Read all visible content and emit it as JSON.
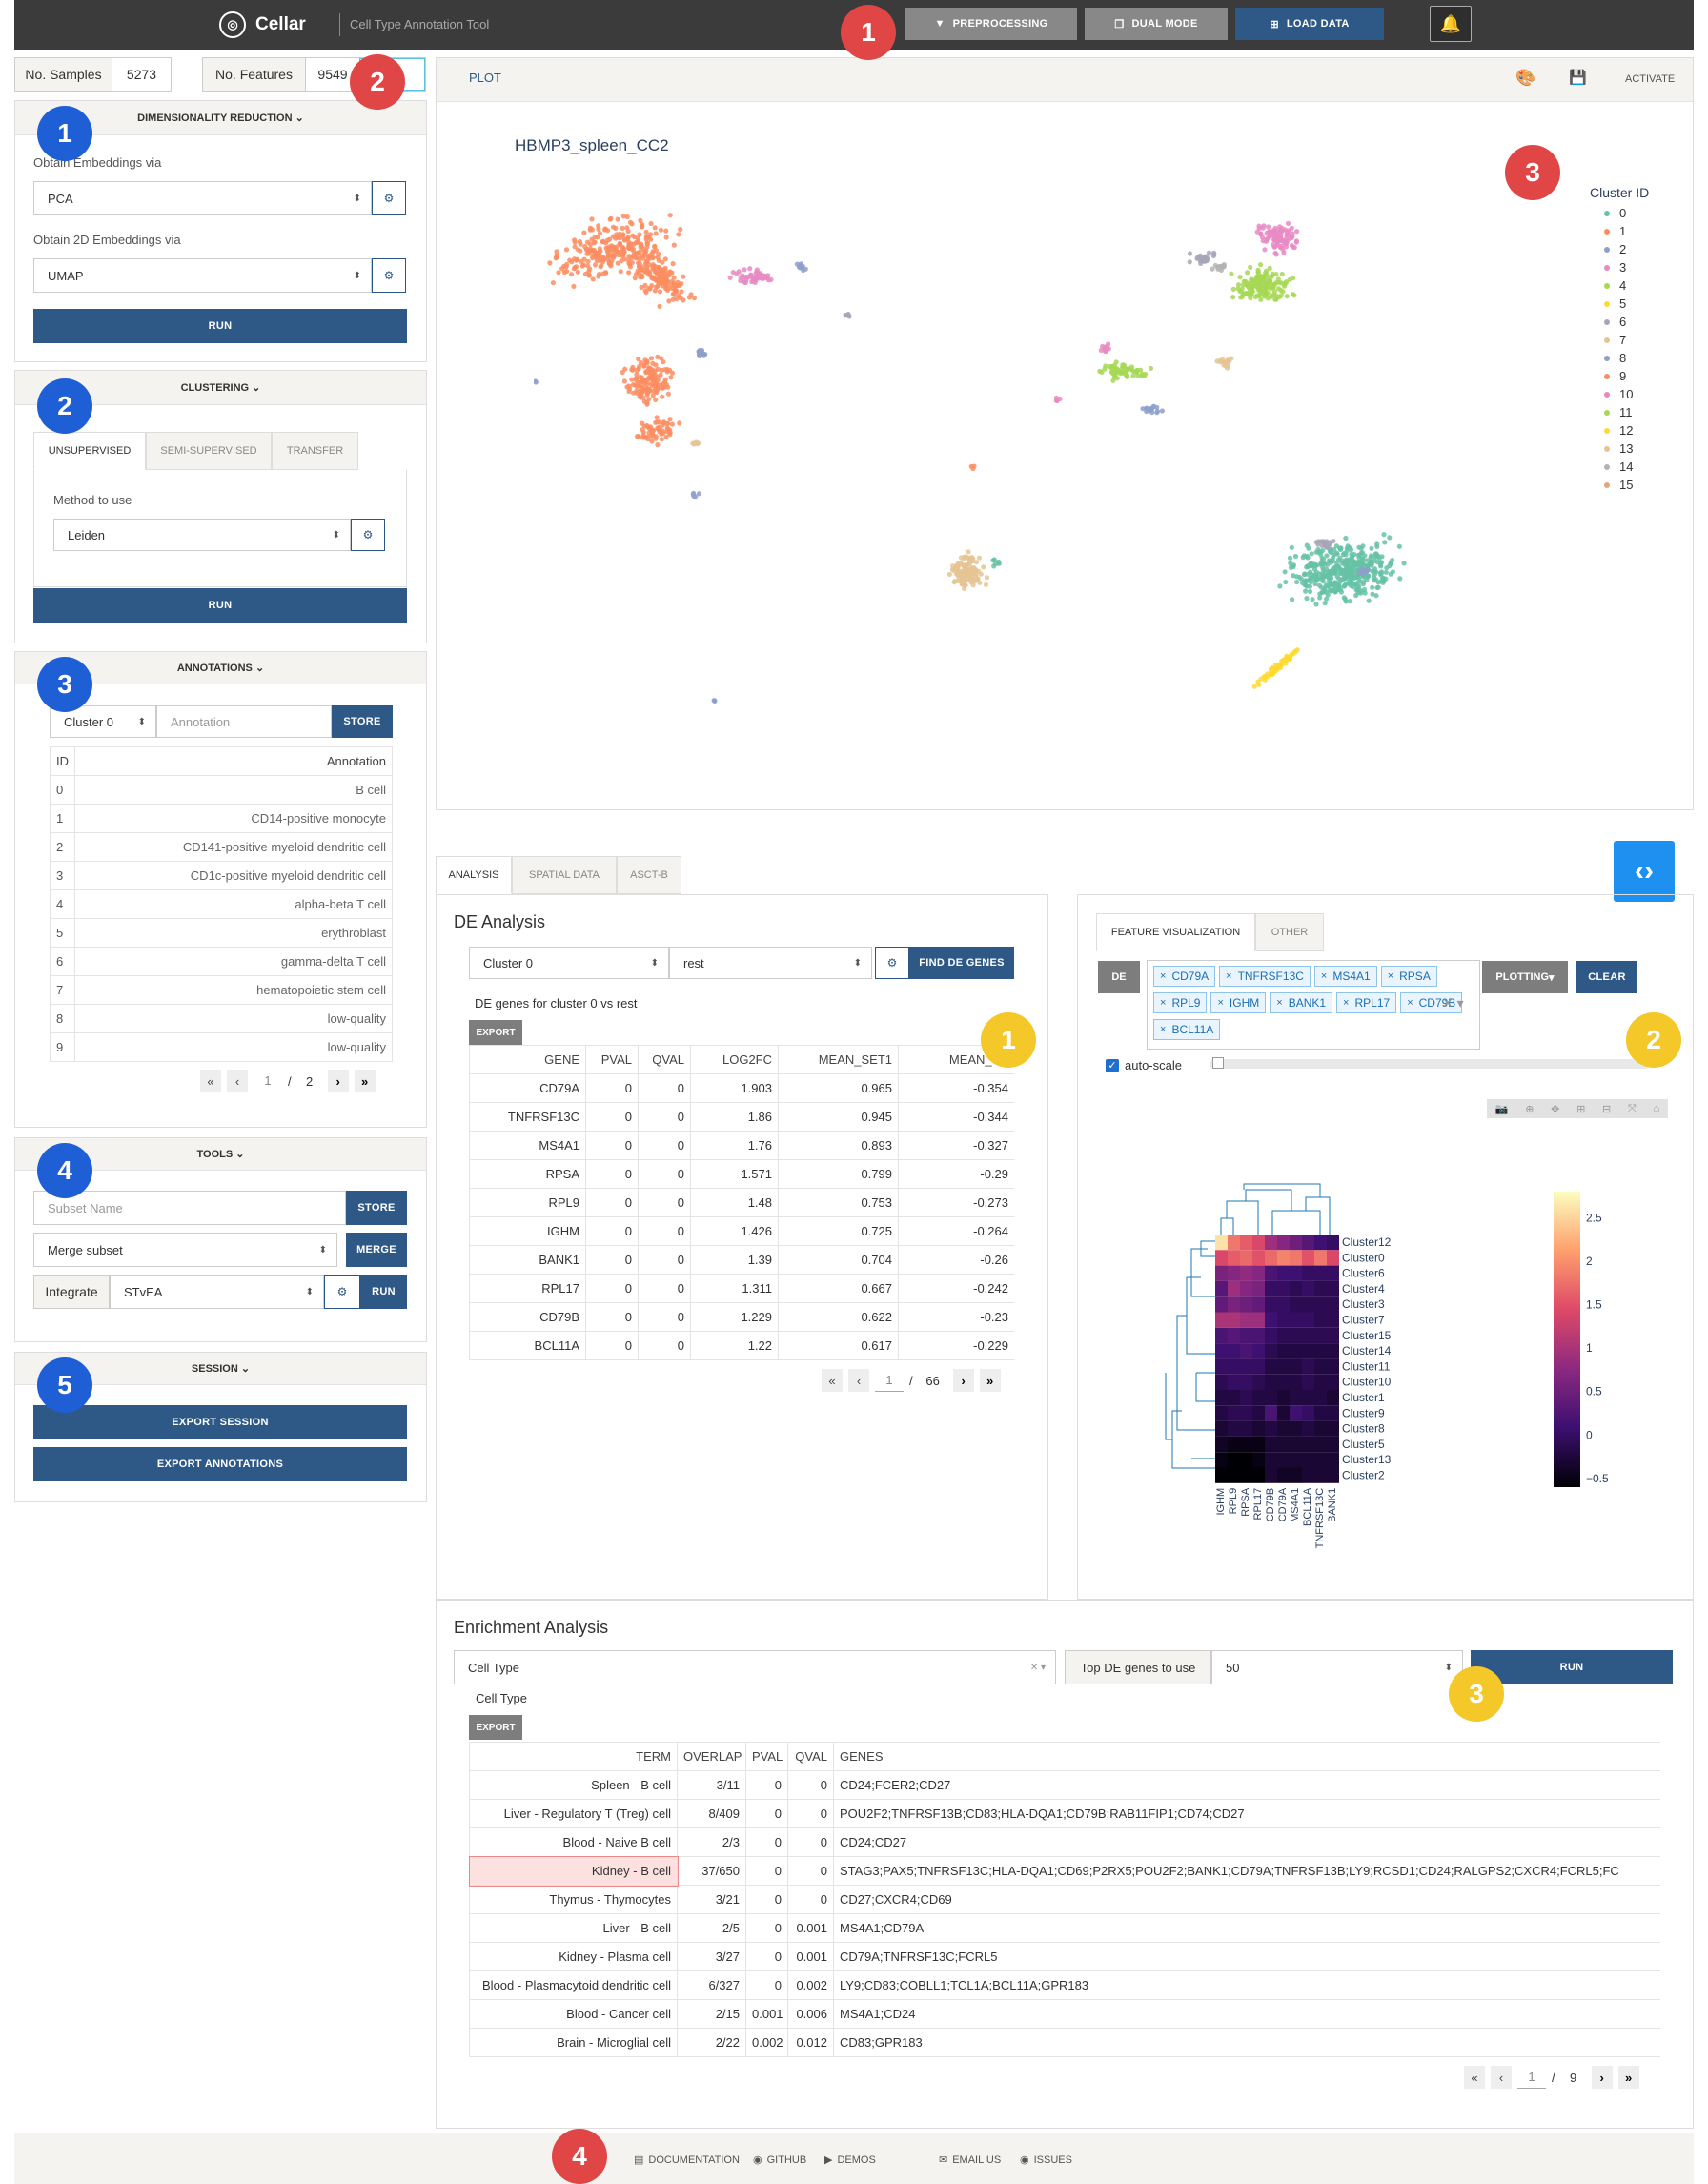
{
  "header": {
    "app_name": "Cellar",
    "subtitle": "Cell Type Annotation Tool",
    "buttons": [
      {
        "label": "PREPROCESSING",
        "icon": "filter-icon",
        "color": "#888888"
      },
      {
        "label": "DUAL MODE",
        "icon": "copy-icon",
        "color": "#888888"
      },
      {
        "label": "LOAD DATA",
        "icon": "plus-square-icon",
        "color": "#2e5987"
      }
    ]
  },
  "stats": {
    "samples_label": "No. Samples",
    "samples_value": "5273",
    "features_label": "No. Features",
    "features_value": "9549"
  },
  "dimred": {
    "title": "DIMENSIONALITY REDUCTION",
    "embed_label": "Obtain Embeddings via",
    "embed_value": "PCA",
    "embed2d_label": "Obtain 2D Embeddings via",
    "embed2d_value": "UMAP",
    "run": "RUN"
  },
  "clustering": {
    "title": "CLUSTERING",
    "tabs": [
      "UNSUPERVISED",
      "SEMI-SUPERVISED",
      "TRANSFER"
    ],
    "method_label": "Method to use",
    "method_value": "Leiden",
    "run": "RUN"
  },
  "annotations": {
    "title": "ANNOTATIONS",
    "cluster_select": "Cluster 0",
    "annotation_placeholder": "Annotation",
    "store": "STORE",
    "col_id": "ID",
    "col_annotation": "Annotation",
    "rows": [
      {
        "id": "0",
        "name": "B cell"
      },
      {
        "id": "1",
        "name": "CD14-positive monocyte"
      },
      {
        "id": "2",
        "name": "CD141-positive myeloid dendritic cell"
      },
      {
        "id": "3",
        "name": "CD1c-positive myeloid dendritic cell"
      },
      {
        "id": "4",
        "name": "alpha-beta T cell"
      },
      {
        "id": "5",
        "name": "erythroblast"
      },
      {
        "id": "6",
        "name": "gamma-delta T cell"
      },
      {
        "id": "7",
        "name": "hematopoietic stem cell"
      },
      {
        "id": "8",
        "name": "low-quality"
      },
      {
        "id": "9",
        "name": "low-quality"
      }
    ],
    "page": "1",
    "sep": "/",
    "pages": "2"
  },
  "tools": {
    "title": "TOOLS",
    "subset_placeholder": "Subset Name",
    "store": "STORE",
    "merge_value": "Merge subset",
    "merge": "MERGE",
    "integrate_label": "Integrate",
    "integrate_value": "STvEA",
    "run": "RUN"
  },
  "session": {
    "title": "SESSION",
    "export_session": "EXPORT SESSION",
    "export_annotations": "EXPORT ANNOTATIONS"
  },
  "plot": {
    "header": "PLOT",
    "activate": "ACTIVATE",
    "dataset_title": "HBMP3_spleen_CC2",
    "legend_title": "Cluster ID",
    "clusters": [
      {
        "id": "0",
        "color": "#66c2a5"
      },
      {
        "id": "1",
        "color": "#fc8d62"
      },
      {
        "id": "2",
        "color": "#8da0cb"
      },
      {
        "id": "3",
        "color": "#e78ac3"
      },
      {
        "id": "4",
        "color": "#a6d854"
      },
      {
        "id": "5",
        "color": "#ffd92f"
      },
      {
        "id": "6",
        "color": "#a6a6b8"
      },
      {
        "id": "7",
        "color": "#e5c494"
      },
      {
        "id": "8",
        "color": "#8da0cb"
      },
      {
        "id": "9",
        "color": "#fc8d62"
      },
      {
        "id": "10",
        "color": "#e78ac3"
      },
      {
        "id": "11",
        "color": "#a6d854"
      },
      {
        "id": "12",
        "color": "#ffd92f"
      },
      {
        "id": "13",
        "color": "#e5c494"
      },
      {
        "id": "14",
        "color": "#b3b3b3"
      },
      {
        "id": "15",
        "color": "#e5a77a"
      }
    ]
  },
  "analysis_tabs": [
    "ANALYSIS",
    "SPATIAL DATA",
    "ASCT-B"
  ],
  "de": {
    "title": "DE Analysis",
    "cluster": "Cluster 0",
    "vs": "rest",
    "find_btn": "FIND DE GENES",
    "caption": "DE genes for cluster 0 vs rest",
    "export": "EXPORT",
    "columns": [
      "GENE",
      "PVAL",
      "QVAL",
      "LOG2FC",
      "MEAN_SET1",
      "MEAN_SE"
    ],
    "rows": [
      [
        "CD79A",
        "0",
        "0",
        "1.903",
        "0.965",
        "-0.354"
      ],
      [
        "TNFRSF13C",
        "0",
        "0",
        "1.86",
        "0.945",
        "-0.344"
      ],
      [
        "MS4A1",
        "0",
        "0",
        "1.76",
        "0.893",
        "-0.327"
      ],
      [
        "RPSA",
        "0",
        "0",
        "1.571",
        "0.799",
        "-0.29"
      ],
      [
        "RPL9",
        "0",
        "0",
        "1.48",
        "0.753",
        "-0.273"
      ],
      [
        "IGHM",
        "0",
        "0",
        "1.426",
        "0.725",
        "-0.264"
      ],
      [
        "BANK1",
        "0",
        "0",
        "1.39",
        "0.704",
        "-0.26"
      ],
      [
        "RPL17",
        "0",
        "0",
        "1.311",
        "0.667",
        "-0.242"
      ],
      [
        "CD79B",
        "0",
        "0",
        "1.229",
        "0.622",
        "-0.23"
      ],
      [
        "BCL11A",
        "0",
        "0",
        "1.22",
        "0.617",
        "-0.229"
      ]
    ],
    "page": "1",
    "sep": "/",
    "pages": "66"
  },
  "feature_vis": {
    "tabs": [
      "FEATURE VISUALIZATION",
      "OTHER"
    ],
    "de_label": "DE",
    "chips": [
      "CD79A",
      "TNFRSF13C",
      "MS4A1",
      "RPSA",
      "RPL9",
      "IGHM",
      "BANK1",
      "RPL17",
      "CD79B",
      "BCL11A"
    ],
    "plotting": "PLOTTING",
    "clear": "CLEAR",
    "autoscale": "auto-scale"
  },
  "chart_data": {
    "type": "heatmap",
    "rows": [
      "Cluster12",
      "Cluster0",
      "Cluster6",
      "Cluster4",
      "Cluster3",
      "Cluster7",
      "Cluster15",
      "Cluster14",
      "Cluster11",
      "Cluster10",
      "Cluster1",
      "Cluster9",
      "Cluster8",
      "Cluster5",
      "Cluster13",
      "Cluster2"
    ],
    "columns": [
      "IGHM",
      "RPL9",
      "RPSA",
      "RPL17",
      "CD79B",
      "CD79A",
      "MS4A1",
      "BCL11A",
      "TNFRSF13C",
      "BANK1"
    ],
    "values": [
      [
        2.6,
        1.8,
        1.6,
        1.4,
        0.9,
        0.7,
        0.5,
        0.3,
        0.1,
        0.0
      ],
      [
        1.4,
        1.6,
        1.7,
        1.5,
        1.7,
        1.9,
        1.8,
        1.5,
        1.8,
        1.4
      ],
      [
        0.6,
        0.7,
        0.8,
        0.7,
        0.2,
        0.1,
        0.1,
        0.0,
        0.0,
        0.0
      ],
      [
        0.3,
        0.9,
        0.7,
        0.6,
        0.0,
        0.0,
        -0.1,
        0.0,
        -0.1,
        -0.1
      ],
      [
        0.4,
        0.6,
        0.5,
        0.4,
        0.0,
        0.0,
        -0.1,
        -0.1,
        -0.1,
        -0.1
      ],
      [
        1.0,
        1.0,
        0.9,
        0.9,
        0.1,
        0.0,
        0.0,
        0.0,
        -0.1,
        -0.1
      ],
      [
        0.2,
        0.3,
        0.2,
        0.2,
        0.0,
        -0.1,
        -0.1,
        -0.1,
        -0.1,
        -0.1
      ],
      [
        0.1,
        0.1,
        0.2,
        0.1,
        -0.1,
        -0.2,
        -0.2,
        -0.2,
        -0.2,
        -0.2
      ],
      [
        0.0,
        0.0,
        0.0,
        0.0,
        -0.2,
        -0.2,
        -0.2,
        -0.1,
        -0.2,
        -0.2
      ],
      [
        -0.1,
        0.0,
        0.0,
        -0.1,
        -0.2,
        -0.2,
        -0.2,
        -0.1,
        -0.2,
        -0.2
      ],
      [
        -0.2,
        -0.2,
        -0.1,
        -0.2,
        -0.2,
        -0.3,
        -0.2,
        -0.2,
        -0.2,
        -0.3
      ],
      [
        -0.2,
        -0.1,
        -0.1,
        -0.2,
        0.2,
        -0.3,
        0.1,
        0.0,
        -0.2,
        -0.2
      ],
      [
        -0.3,
        -0.2,
        -0.2,
        -0.3,
        -0.2,
        -0.3,
        -0.3,
        -0.2,
        -0.3,
        -0.3
      ],
      [
        -0.4,
        -0.5,
        -0.5,
        -0.5,
        -0.3,
        -0.3,
        -0.3,
        -0.3,
        -0.3,
        -0.3
      ],
      [
        -0.5,
        -0.6,
        -0.6,
        -0.5,
        -0.3,
        -0.3,
        -0.3,
        -0.3,
        -0.3,
        -0.3
      ],
      [
        -0.6,
        -0.6,
        -0.6,
        -0.6,
        -0.3,
        -0.4,
        -0.4,
        -0.3,
        -0.3,
        -0.3
      ]
    ],
    "colorbar_ticks": [
      "2.5",
      "2",
      "1.5",
      "1",
      "0.5",
      "0",
      "−0.5"
    ],
    "zrange": [
      -0.6,
      2.8
    ]
  },
  "enrichment": {
    "title": "Enrichment Analysis",
    "set_value": "Cell Type",
    "top_label": "Top DE genes to use",
    "top_value": "50",
    "run": "RUN",
    "caption": "Cell Type",
    "export": "EXPORT",
    "columns": [
      "TERM",
      "OVERLAP",
      "PVAL",
      "QVAL",
      "GENES"
    ],
    "rows": [
      [
        "Spleen - B cell",
        "3/11",
        "0",
        "0",
        "CD24;FCER2;CD27"
      ],
      [
        "Liver - Regulatory T (Treg) cell",
        "8/409",
        "0",
        "0",
        "POU2F2;TNFRSF13B;CD83;HLA-DQA1;CD79B;RAB11FIP1;CD74;CD27"
      ],
      [
        "Blood - Naive B cell",
        "2/3",
        "0",
        "0",
        "CD24;CD27"
      ],
      [
        "Kidney - B cell",
        "37/650",
        "0",
        "0",
        "STAG3;PAX5;TNFRSF13C;HLA-DQA1;CD69;P2RX5;POU2F2;BANK1;CD79A;TNFRSF13B;LY9;RCSD1;CD24;RALGPS2;CXCR4;FCRL5;FC"
      ],
      [
        "Thymus - Thymocytes",
        "3/21",
        "0",
        "0",
        "CD27;CXCR4;CD69"
      ],
      [
        "Liver - B cell",
        "2/5",
        "0",
        "0.001",
        "MS4A1;CD79A"
      ],
      [
        "Kidney - Plasma cell",
        "3/27",
        "0",
        "0.001",
        "CD79A;TNFRSF13C;FCRL5"
      ],
      [
        "Blood - Plasmacytoid dendritic cell",
        "6/327",
        "0",
        "0.002",
        "LY9;CD83;COBLL1;TCL1A;BCL11A;GPR183"
      ],
      [
        "Blood - Cancer cell",
        "2/15",
        "0.001",
        "0.006",
        "MS4A1;CD24"
      ],
      [
        "Brain - Microglial cell",
        "2/22",
        "0.002",
        "0.012",
        "CD83;GPR183"
      ]
    ],
    "highlight_row": 3,
    "page": "1",
    "sep": "/",
    "pages": "9"
  },
  "footer": {
    "links": [
      "DOCUMENTATION",
      "GITHUB",
      "DEMOS",
      "EMAIL US",
      "ISSUES"
    ]
  },
  "callouts": {
    "one": "1",
    "two": "2",
    "three": "3",
    "four": "4",
    "five": "5"
  }
}
